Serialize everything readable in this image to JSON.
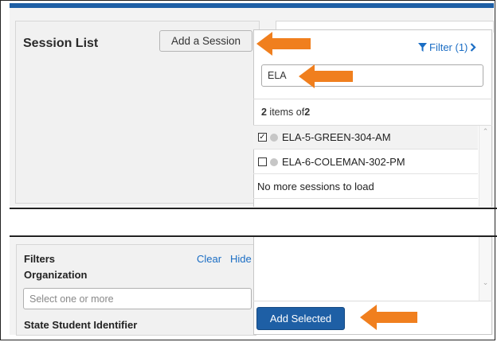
{
  "session_panel": {
    "title": "Session List",
    "add_button": "Add a Session"
  },
  "dropdown": {
    "filter_label": "Filter (1)",
    "search_value": "ELA",
    "count_number": "2",
    "count_text": " items of",
    "count_total": "2",
    "sessions": [
      {
        "name": "ELA-5-GREEN-304-AM",
        "checked": true
      },
      {
        "name": "ELA-6-COLEMAN-302-PM",
        "checked": false
      }
    ],
    "no_more": "No more sessions to load",
    "add_selected": "Add Selected"
  },
  "filters": {
    "title": "Filters",
    "clear": "Clear",
    "hide": "Hide",
    "organization_label": "Organization",
    "organization_placeholder": "Select one or more",
    "student_id_label": "State Student Identifier"
  },
  "colors": {
    "accent": "#1e5fa5",
    "link": "#1a6dc4",
    "callout_arrow": "#f07f1e"
  },
  "icons": {
    "filter": "funnel-icon",
    "chevron": "chevron-right-icon",
    "checked": "checkbox-checked-icon",
    "unchecked": "checkbox-empty-icon",
    "status": "status-dot-icon"
  }
}
